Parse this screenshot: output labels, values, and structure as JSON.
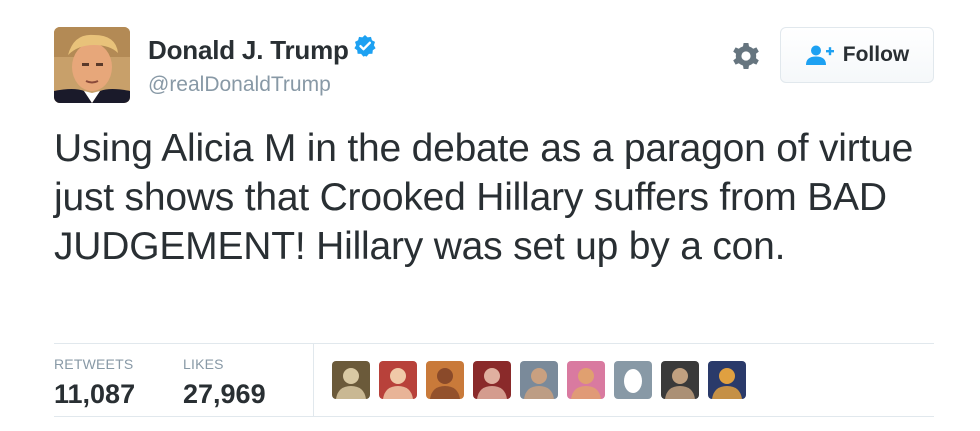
{
  "user": {
    "display_name": "Donald J. Trump",
    "username": "@realDonaldTrump",
    "verified": true,
    "avatar_icon": "profile-photo"
  },
  "header": {
    "settings_icon": "gear-icon",
    "follow_label": "Follow",
    "follow_icon": "add-user-icon"
  },
  "tweet": {
    "text": "Using Alicia M in the debate as a paragon of virtue just shows that Crooked Hillary suffers from BAD JUDGEMENT! Hillary was set up by a con."
  },
  "stats": {
    "retweets_label": "RETWEETS",
    "retweets_value": "11,087",
    "likes_label": "LIKES",
    "likes_value": "27,969"
  },
  "likers": [
    {
      "icon": "user-avatar",
      "bg": "#6b5a3a",
      "fg": "#d9c9a3"
    },
    {
      "icon": "user-avatar",
      "bg": "#b8413a",
      "fg": "#f0c9a8"
    },
    {
      "icon": "user-avatar",
      "bg": "#c97a3a",
      "fg": "#8a4a2a"
    },
    {
      "icon": "user-avatar",
      "bg": "#8a2a2a",
      "fg": "#e0b0a0"
    },
    {
      "icon": "user-avatar",
      "bg": "#7a8a9a",
      "fg": "#c9a080"
    },
    {
      "icon": "user-avatar",
      "bg": "#d97aa0",
      "fg": "#e0a070"
    },
    {
      "icon": "default-egg-avatar",
      "bg": "#8899a6",
      "fg": "#ffffff"
    },
    {
      "icon": "user-avatar",
      "bg": "#3a3a3a",
      "fg": "#c0a080"
    },
    {
      "icon": "user-avatar",
      "bg": "#2a3a6a",
      "fg": "#e0a040"
    }
  ],
  "colors": {
    "text": "#292f33",
    "secondary": "#8899a6",
    "verified_blue": "#1da1f2",
    "follow_blue": "#1da1f2",
    "divider": "#e1e8ed"
  }
}
